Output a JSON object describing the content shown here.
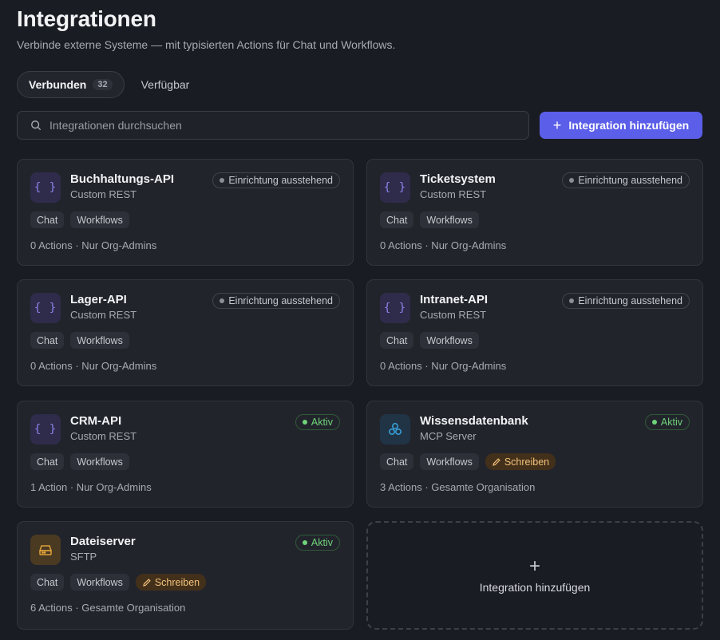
{
  "header": {
    "title": "Integrationen",
    "subtitle": "Verbinde externe Systeme — mit typisierten Actions für Chat und Workflows."
  },
  "tabs": [
    {
      "label": "Verbunden",
      "count": "32",
      "active": true
    },
    {
      "label": "Verfügbar",
      "active": false
    }
  ],
  "search": {
    "placeholder": "Integrationen durchsuchen",
    "value": ""
  },
  "add_button": {
    "label": "Integration hinzufügen",
    "icon": "plus-icon"
  },
  "cards": [
    {
      "name": "Buchhaltungs-API",
      "type": "Custom REST",
      "icon": "code-braces-icon",
      "status": "Einrichtung ausstehend",
      "tags": [
        "Chat",
        "Workflows"
      ],
      "meta": "0 Actions · Nur Org-Admins"
    },
    {
      "name": "Ticketsystem",
      "type": "Custom REST",
      "icon": "code-braces-icon",
      "status": "Einrichtung ausstehend",
      "tags": [
        "Chat",
        "Workflows"
      ],
      "meta": "0 Actions · Nur Org-Admins"
    },
    {
      "name": "Lager-API",
      "type": "Custom REST",
      "icon": "code-braces-icon",
      "status": "Einrichtung ausstehend",
      "tags": [
        "Chat",
        "Workflows"
      ],
      "meta": "0 Actions · Nur Org-Admins"
    },
    {
      "name": "Intranet-API",
      "type": "Custom REST",
      "icon": "code-braces-icon",
      "status": "Einrichtung ausstehend",
      "tags": [
        "Chat",
        "Workflows"
      ],
      "meta": "0 Actions · Nur Org-Admins"
    },
    {
      "name": "CRM-API",
      "type": "Custom REST",
      "icon": "code-braces-icon",
      "status": "Aktiv",
      "tags": [
        "Chat",
        "Workflows"
      ],
      "meta": "1 Action · Nur Org-Admins"
    },
    {
      "name": "Wissensdatenbank",
      "type": "MCP Server",
      "icon": "mcp-server-icon",
      "status": "Aktiv",
      "tags": [
        "Chat",
        "Workflows"
      ],
      "write_tag": "Schreiben",
      "meta": "3 Actions · Gesamte Organisation"
    },
    {
      "name": "Dateiserver",
      "type": "SFTP",
      "icon": "hard-drive-icon",
      "status": "Aktiv",
      "tags": [
        "Chat",
        "Workflows"
      ],
      "write_tag": "Schreiben",
      "meta": "6 Actions · Gesamte Organisation"
    }
  ],
  "add_card": {
    "label": "Integration hinzufügen",
    "icon": "plus-icon"
  },
  "colors": {
    "accent": "#5b5ee8",
    "active_status": "#6fd37a",
    "write_tag": "#f2c27c",
    "rest_icon": "#8c86ee",
    "mcp_icon": "#3aa5e0",
    "sftp_icon": "#e0a23a"
  }
}
